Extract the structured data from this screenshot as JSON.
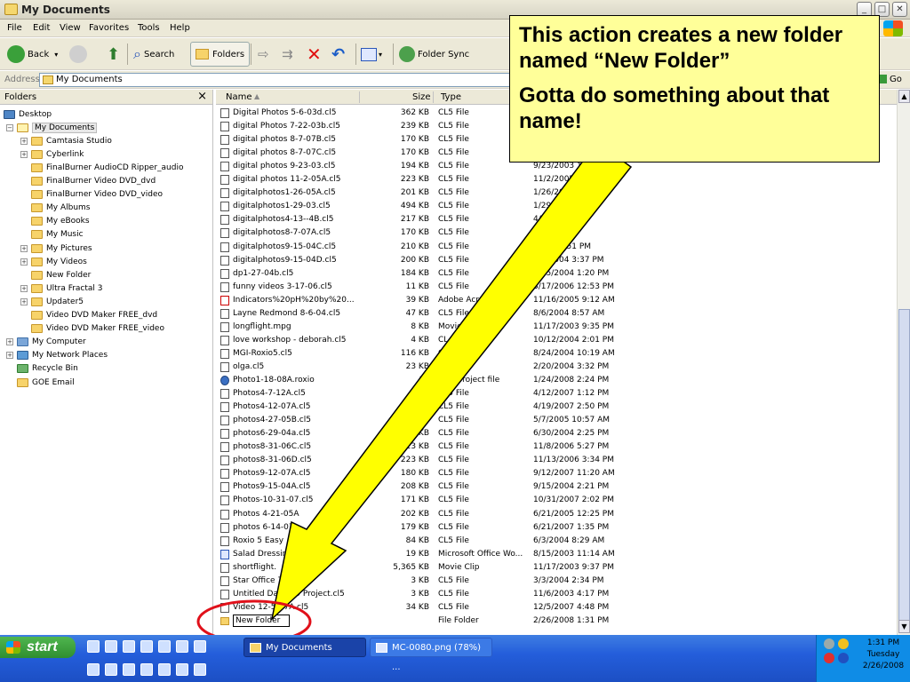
{
  "window": {
    "title": "My Documents",
    "min": "_",
    "max": "□",
    "close": "✕"
  },
  "menu": [
    "File",
    "Edit",
    "View",
    "Favorites",
    "Tools",
    "Help"
  ],
  "toolbar": {
    "back": "Back",
    "search": "Search",
    "folders": "Folders",
    "folder_sync": "Folder Sync"
  },
  "address": {
    "label": "Address",
    "value": "My Documents",
    "go": "Go"
  },
  "folders_pane": {
    "title": "Folders",
    "close": "×",
    "items": [
      {
        "label": "Desktop",
        "depth": 0,
        "icon": "desk",
        "expander": ""
      },
      {
        "label": "My Documents",
        "depth": 1,
        "icon": "doc",
        "expander": "−",
        "selected": true
      },
      {
        "label": "Camtasia Studio",
        "depth": 2,
        "icon": "fold",
        "expander": "+"
      },
      {
        "label": "Cyberlink",
        "depth": 2,
        "icon": "fold",
        "expander": "+"
      },
      {
        "label": "FinalBurner AudioCD Ripper_audio",
        "depth": 2,
        "icon": "fold",
        "expander": ""
      },
      {
        "label": "FinalBurner Video DVD_dvd",
        "depth": 2,
        "icon": "fold",
        "expander": ""
      },
      {
        "label": "FinalBurner Video DVD_video",
        "depth": 2,
        "icon": "fold",
        "expander": ""
      },
      {
        "label": "My Albums",
        "depth": 2,
        "icon": "fold",
        "expander": ""
      },
      {
        "label": "My eBooks",
        "depth": 2,
        "icon": "fold",
        "expander": ""
      },
      {
        "label": "My Music",
        "depth": 2,
        "icon": "fold",
        "expander": ""
      },
      {
        "label": "My Pictures",
        "depth": 2,
        "icon": "fold",
        "expander": "+"
      },
      {
        "label": "My Videos",
        "depth": 2,
        "icon": "fold",
        "expander": "+"
      },
      {
        "label": "New Folder",
        "depth": 2,
        "icon": "fold",
        "expander": ""
      },
      {
        "label": "Ultra Fractal 3",
        "depth": 2,
        "icon": "fold",
        "expander": "+"
      },
      {
        "label": "Updater5",
        "depth": 2,
        "icon": "fold",
        "expander": "+"
      },
      {
        "label": "Video DVD Maker FREE_dvd",
        "depth": 2,
        "icon": "fold",
        "expander": ""
      },
      {
        "label": "Video DVD Maker FREE_video",
        "depth": 2,
        "icon": "fold",
        "expander": ""
      },
      {
        "label": "My Computer",
        "depth": 1,
        "icon": "pc",
        "expander": "+"
      },
      {
        "label": "My Network Places",
        "depth": 1,
        "icon": "net",
        "expander": "+"
      },
      {
        "label": "Recycle Bin",
        "depth": 1,
        "icon": "bin",
        "expander": ""
      },
      {
        "label": "GOE Email",
        "depth": 1,
        "icon": "fold",
        "expander": ""
      }
    ]
  },
  "columns": {
    "name": "Name",
    "size": "Size",
    "type": "Type"
  },
  "files": [
    {
      "name": "Digital Photos 5-6-03d.cl5",
      "size": "362 KB",
      "type": "CL5 File",
      "date": ""
    },
    {
      "name": "digital Photos 7-22-03b.cl5",
      "size": "239 KB",
      "type": "CL5 File",
      "date": ""
    },
    {
      "name": "digital photos 8-7-07B.cl5",
      "size": "170 KB",
      "type": "CL5 File",
      "date": ""
    },
    {
      "name": "digital photos 8-7-07C.cl5",
      "size": "170 KB",
      "type": "CL5 File",
      "date": ""
    },
    {
      "name": "digital photos 9-23-03.cl5",
      "size": "194 KB",
      "type": "CL5 File",
      "date": "9/23/2003 10:2"
    },
    {
      "name": "digital photos 11-2-05A.cl5",
      "size": "223 KB",
      "type": "CL5 File",
      "date": "11/2/2005 2"
    },
    {
      "name": "digitalphotos1-26-05A.cl5",
      "size": "201 KB",
      "type": "CL5 File",
      "date": "1/26/200    M"
    },
    {
      "name": "digitalphotos1-29-03.cl5",
      "size": "494 KB",
      "type": "CL5 File",
      "date": "1/29/2    8 PM"
    },
    {
      "name": "digitalphotos4-13--4B.cl5",
      "size": "217 KB",
      "type": "CL5 File",
      "date": "4/2    12:38 PM"
    },
    {
      "name": "digitalphotos8-7-07A.cl5",
      "size": "170 KB",
      "type": "CL5 File",
      "date": "8    10:33 AM"
    },
    {
      "name": "digitalphotos9-15-04C.cl5",
      "size": "210 KB",
      "type": "CL5 File",
      "date": "    /2004 3:51 PM"
    },
    {
      "name": "digitalphotos9-15-04D.cl5",
      "size": "200 KB",
      "type": "CL5 File",
      "date": "  /16/2004 3:37 PM"
    },
    {
      "name": "dp1-27-04b.cl5",
      "size": "184 KB",
      "type": "CL5 File",
      "date": "2/25/2004 1:20 PM"
    },
    {
      "name": "funny videos 3-17-06.cl5",
      "size": "11 KB",
      "type": "CL5 File",
      "date": "3/17/2006 12:53 PM"
    },
    {
      "name": "Indicators%20pH%20by%20...",
      "size": "39 KB",
      "type": "Adobe Acro",
      "date": "11/16/2005 9:12 AM"
    },
    {
      "name": "Layne Redmond 8-6-04.cl5",
      "size": "47 KB",
      "type": "CL5 File",
      "date": "8/6/2004 8:57 AM"
    },
    {
      "name": "longflight.mpg",
      "size": "8 KB",
      "type": "Movie",
      "date": "11/17/2003 9:35 PM"
    },
    {
      "name": "love workshop - deborah.cl5",
      "size": "4 KB",
      "type": "CL",
      "date": "10/12/2004 2:01 PM"
    },
    {
      "name": "MGI-Roxio5.cl5",
      "size": "116 KB",
      "type": "C",
      "date": "8/24/2004 10:19 AM"
    },
    {
      "name": "olga.cl5",
      "size": "23 KB",
      "type": "    ile",
      "date": "2/20/2004 3:32 PM"
    },
    {
      "name": "Photo1-18-08A.roxio",
      "size": "13",
      "type": "oxio project file",
      "date": "1/24/2008 2:24 PM"
    },
    {
      "name": "Photos4-7-12A.cl5",
      "size": "1",
      "type": "CL5 File",
      "date": "4/12/2007 1:12 PM"
    },
    {
      "name": "Photos4-12-07A.cl5",
      "size": "",
      "type": "CL5 File",
      "date": "4/19/2007 2:50 PM"
    },
    {
      "name": "photos4-27-05B.cl5",
      "size": "KB",
      "type": "CL5 File",
      "date": "5/7/2005 10:57 AM"
    },
    {
      "name": "photos6-29-04a.cl5",
      "size": "224 KB",
      "type": "CL5 File",
      "date": "6/30/2004 2:25 PM"
    },
    {
      "name": "photos8-31-06C.cl5",
      "size": "223 KB",
      "type": "CL5 File",
      "date": "11/8/2006 5:27 PM"
    },
    {
      "name": "photos8-31-06D.cl5",
      "size": "223 KB",
      "type": "CL5 File",
      "date": "11/13/2006 3:34 PM"
    },
    {
      "name": "Photos9-12-07A.cl5",
      "size": "180 KB",
      "type": "CL5 File",
      "date": "9/12/2007 11:20 AM"
    },
    {
      "name": "Photos9-15-04A.cl5",
      "size": "208 KB",
      "type": "CL5 File",
      "date": "9/15/2004 2:21 PM"
    },
    {
      "name": "Photos-10-31-07.cl5",
      "size": "171 KB",
      "type": "CL5 File",
      "date": "10/31/2007 2:02 PM"
    },
    {
      "name": "Photos 4-21-05A",
      "size": "202 KB",
      "type": "CL5 File",
      "date": "6/21/2005 12:25 PM"
    },
    {
      "name": "photos 6-14-07",
      "size": "179 KB",
      "type": "CL5 File",
      "date": "6/21/2007 1:35 PM"
    },
    {
      "name": "Roxio 5 Easy",
      "size": "84 KB",
      "type": "CL5 File",
      "date": "6/3/2004 8:29 AM"
    },
    {
      "name": "Salad Dressin",
      "size": "19 KB",
      "type": "Microsoft Office Wo...",
      "date": "8/15/2003 11:14 AM"
    },
    {
      "name": "shortflight.",
      "size": "5,365 KB",
      "type": "Movie Clip",
      "date": "11/17/2003 9:37 PM"
    },
    {
      "name": "Star Office 7.cl5",
      "size": "3 KB",
      "type": "CL5 File",
      "date": "3/3/2004 2:34 PM"
    },
    {
      "name": "Untitled Data CD Project.cl5",
      "size": "3 KB",
      "type": "CL5 File",
      "date": "11/6/2003 4:17 PM"
    },
    {
      "name": "Video 12-5-07A.cl5",
      "size": "34 KB",
      "type": "CL5 File",
      "date": "12/5/2007 4:48 PM"
    },
    {
      "name": "New Folder",
      "size": "",
      "type": "File Folder",
      "date": "2/26/2008 1:31 PM",
      "renaming": true
    }
  ],
  "callout": {
    "line1": "This action creates a new folder named “New Folder”",
    "line2": "Gotta do something about that name!"
  },
  "taskbar": {
    "start": "start",
    "tasks": [
      "My Documents",
      "MC-0080.png (78%) ..."
    ],
    "time": "1:31 PM",
    "day": "Tuesday",
    "date": "2/26/2008"
  },
  "colors": {
    "callout_bg": "#ffff99",
    "arrow": "#ffff00",
    "circle": "#e0101a",
    "taskbar": "#245edb",
    "tray": "#0f8ce6"
  }
}
